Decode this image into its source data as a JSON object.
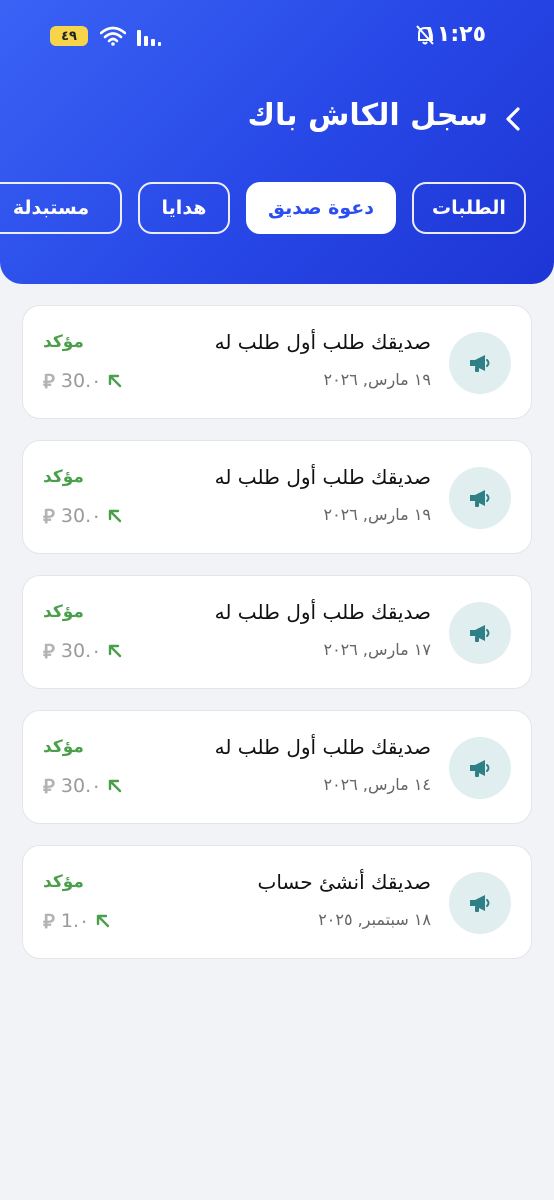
{
  "status_bar": {
    "time": "١١:٢٥",
    "battery": "٤٩"
  },
  "header": {
    "title": "سجل الكاش باك"
  },
  "tabs": [
    {
      "label": "الطلبات",
      "active": false
    },
    {
      "label": "دعوة صديق",
      "active": true
    },
    {
      "label": "هدايا",
      "active": false
    },
    {
      "label": "مستبدلة",
      "active": false
    }
  ],
  "items": [
    {
      "title": "صديقك طلب أول طلب له",
      "date": "١٩ مارس, ٢٠٢٦",
      "status": "مؤكد",
      "currency": "⃁",
      "amount": "30.٠"
    },
    {
      "title": "صديقك طلب أول طلب له",
      "date": "١٩ مارس, ٢٠٢٦",
      "status": "مؤكد",
      "currency": "⃁",
      "amount": "30.٠"
    },
    {
      "title": "صديقك طلب أول طلب له",
      "date": "١٧ مارس, ٢٠٢٦",
      "status": "مؤكد",
      "currency": "⃁",
      "amount": "30.٠"
    },
    {
      "title": "صديقك طلب أول طلب له",
      "date": "١٤ مارس, ٢٠٢٦",
      "status": "مؤكد",
      "currency": "⃁",
      "amount": "30.٠"
    },
    {
      "title": "صديقك أنشئ حساب",
      "date": "١٨ سبتمبر, ٢٠٢٥",
      "status": "مؤكد",
      "currency": "⃁",
      "amount": "1.٠"
    }
  ],
  "colors": {
    "header_start": "#3a63f5",
    "header_end": "#1e35d4",
    "status_green": "#4aa04a",
    "active_tab_text": "#2b4ef0",
    "icon_bg": "#e1eeef",
    "icon_fg": "#2f7f86"
  },
  "icons": {
    "card_icon": "megaphone-icon",
    "back": "chevron-left-icon",
    "amount_arrow": "arrow-up-left-icon"
  }
}
